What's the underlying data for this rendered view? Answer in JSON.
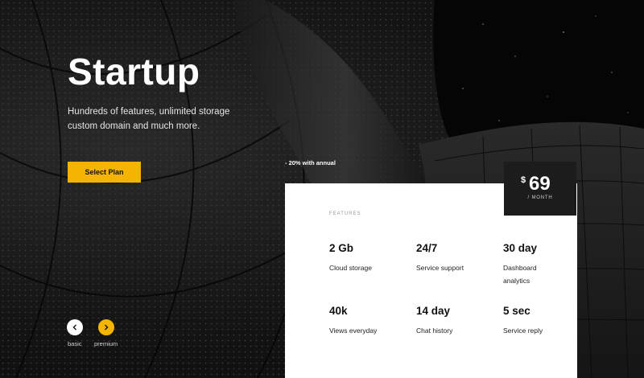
{
  "hero": {
    "title": "Startup",
    "subtitle": "Hundreds of features, unlimited storage custom domain and much more.",
    "cta_label": "Select Plan"
  },
  "pricing": {
    "discount_note": "- 20% with annual",
    "currency": "$",
    "amount": "69",
    "period": "/ MONTH",
    "features_heading": "FEATURES",
    "features": [
      {
        "value": "2 Gb",
        "desc": "Cloud storage"
      },
      {
        "value": "24/7",
        "desc": "Service support"
      },
      {
        "value": "30 day",
        "desc": "Dashboard analytics"
      },
      {
        "value": "40k",
        "desc": "Views everyday"
      },
      {
        "value": "14 day",
        "desc": "Chat history"
      },
      {
        "value": "5 sec",
        "desc": "Service reply"
      }
    ]
  },
  "slider_nav": {
    "prev_label": "basic",
    "next_label": "premium",
    "prev_icon": "chevron-left-icon",
    "next_icon": "chevron-right-icon"
  },
  "colors": {
    "accent": "#f5b400",
    "background": "#111111",
    "card": "#ffffff",
    "price_box": "#1c1c1c"
  }
}
